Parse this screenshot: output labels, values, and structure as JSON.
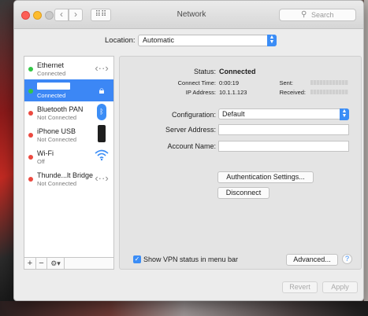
{
  "window": {
    "title": "Network",
    "search_placeholder": "Search",
    "back_glyph": "‹",
    "forward_glyph": "›",
    "grid_glyph": "⠿⠿"
  },
  "location": {
    "label": "Location:",
    "value": "Automatic"
  },
  "services": [
    {
      "name": "Ethernet",
      "status": "Connected",
      "dot": "green",
      "icon": "ethernet-icon"
    },
    {
      "name": "",
      "status": "Connected",
      "dot": "green",
      "icon": "vpn-lock-icon",
      "selected": true
    },
    {
      "name": "Bluetooth PAN",
      "status": "Not Connected",
      "dot": "red",
      "icon": "bluetooth-icon"
    },
    {
      "name": "iPhone USB",
      "status": "Not Connected",
      "dot": "red",
      "icon": "iphone-icon"
    },
    {
      "name": "Wi-Fi",
      "status": "Off",
      "dot": "red",
      "icon": "wifi-icon"
    },
    {
      "name": "Thunde...lt Bridge",
      "status": "Not Connected",
      "dot": "red",
      "icon": "thunderbolt-bridge-icon"
    }
  ],
  "sidebar_tools": {
    "add": "+",
    "remove": "−",
    "gear": "⚙▾"
  },
  "detail": {
    "status_label": "Status:",
    "status_value": "Connected",
    "connect_time_label": "Connect Time:",
    "connect_time_value": "0:00:19",
    "ip_label": "IP Address:",
    "ip_value": "10.1.1.123",
    "sent_label": "Sent:",
    "received_label": "Received:",
    "configuration_label": "Configuration:",
    "configuration_value": "Default",
    "server_label": "Server Address:",
    "server_value": "",
    "account_label": "Account Name:",
    "account_value": "",
    "auth_button": "Authentication Settings...",
    "disconnect_button": "Disconnect",
    "show_vpn_label": "Show VPN status in menu bar",
    "show_vpn_checked": true,
    "advanced_button": "Advanced...",
    "help_glyph": "?"
  },
  "footer": {
    "revert": "Revert",
    "apply": "Apply"
  },
  "colors": {
    "accent": "#3c87f5",
    "connected": "#34c747",
    "disconnected": "#ec4a40"
  }
}
